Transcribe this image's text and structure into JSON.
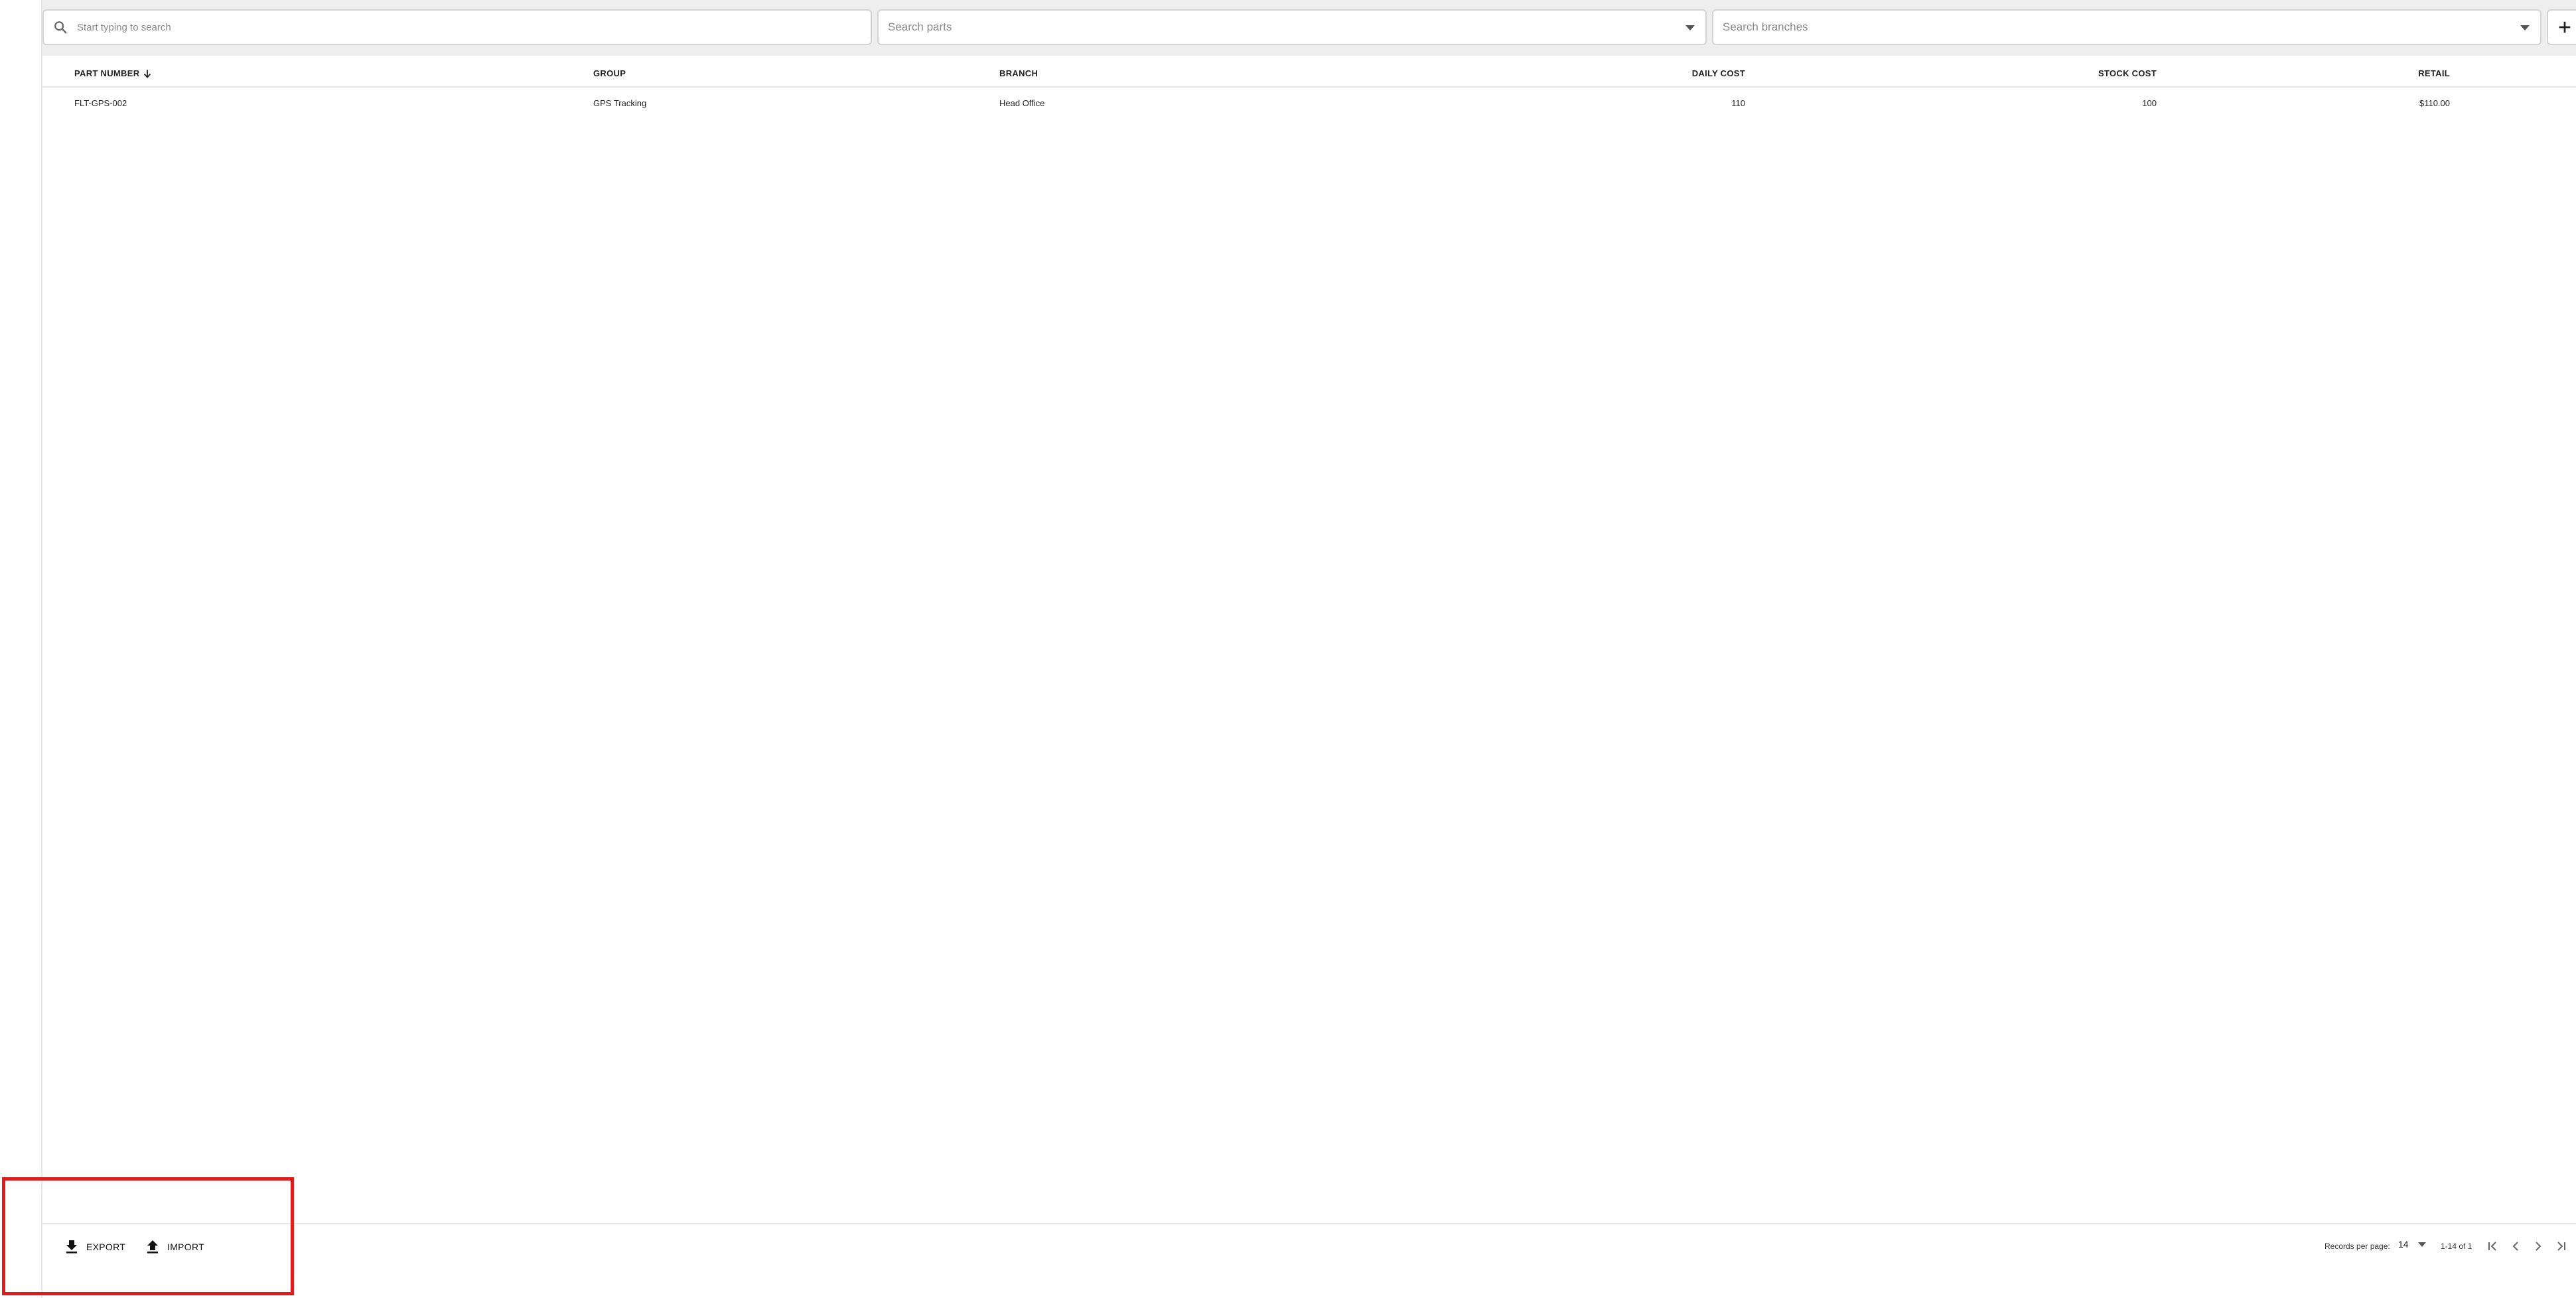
{
  "filters": {
    "search_placeholder": "Start typing to search",
    "parts_placeholder": "Search parts",
    "branches_placeholder": "Search branches"
  },
  "table": {
    "columns": [
      "PART NUMBER",
      "GROUP",
      "BRANCH",
      "DAILY COST",
      "STOCK COST",
      "RETAIL"
    ],
    "rows": [
      {
        "part_number": "FLT-GPS-002",
        "group": "GPS Tracking",
        "branch": "Head Office",
        "daily_cost": "110",
        "stock_cost": "100",
        "retail": "$110.00"
      }
    ]
  },
  "footer": {
    "export_label": "EXPORT",
    "import_label": "IMPORT",
    "records_per_page_label": "Records per page:",
    "records_per_page_value": "14",
    "range_text": "1-14 of 1"
  },
  "colors": {
    "highlight": "#e01b1b",
    "filter_bar_bg": "#eeeeee"
  },
  "icons": [
    "search-icon",
    "dropdown-caret-icon",
    "plus-icon",
    "sort-arrow-down-icon",
    "download-icon",
    "upload-icon",
    "first-page-icon",
    "prev-page-icon",
    "next-page-icon",
    "last-page-icon"
  ]
}
